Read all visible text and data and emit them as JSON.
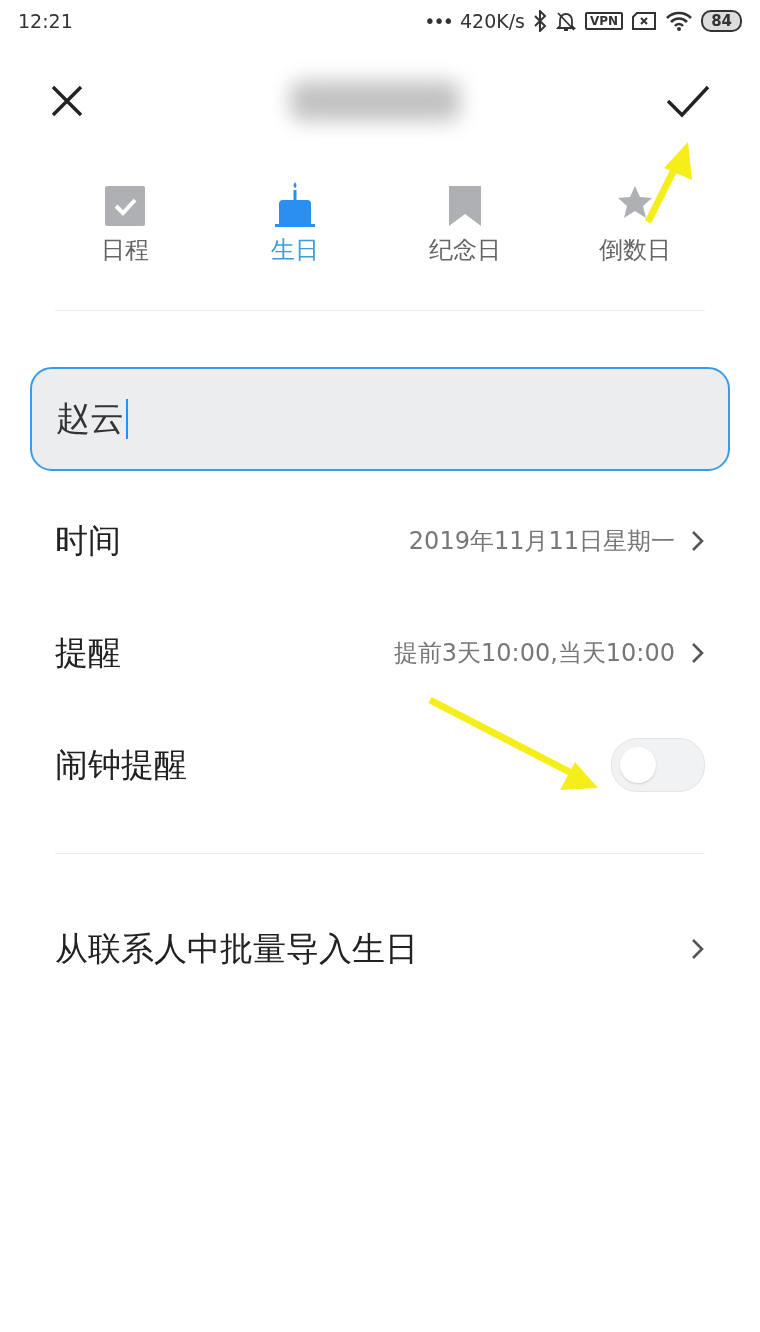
{
  "status_bar": {
    "time": "12:21",
    "dots": "•••",
    "speed": "420K/s",
    "vpn": "VPN",
    "battery": "84"
  },
  "tabs": [
    {
      "label": "日程",
      "kind": "check",
      "selected": false
    },
    {
      "label": "生日",
      "kind": "cake",
      "selected": true
    },
    {
      "label": "纪念日",
      "kind": "bookmark",
      "selected": false
    },
    {
      "label": "倒数日",
      "kind": "star",
      "selected": false
    }
  ],
  "name_field": {
    "value": "赵云"
  },
  "rows": [
    {
      "kind": "link",
      "label": "时间",
      "value": "2019年11月11日星期一"
    },
    {
      "kind": "link",
      "label": "提醒",
      "value": "提前3天10:00,当天10:00"
    },
    {
      "kind": "toggle",
      "label": "闹钟提醒",
      "on": false
    }
  ],
  "import_row": {
    "label": "从联系人中批量导入生日"
  }
}
